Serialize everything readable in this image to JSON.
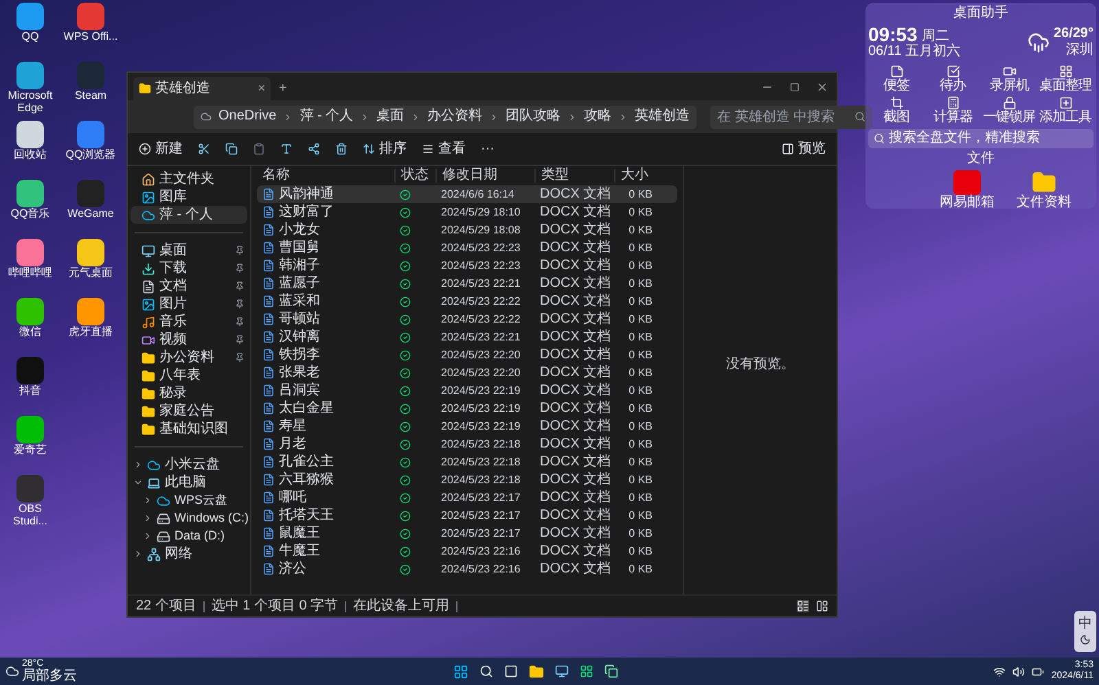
{
  "desktop_icons": [
    {
      "label": "QQ",
      "color": "#1d9bf0"
    },
    {
      "label": "WPS Offi...",
      "color": "#e53935"
    },
    {
      "label": "Microsoft Edge",
      "color": "#1fa4d8"
    },
    {
      "label": "Steam",
      "color": "#1b2838"
    },
    {
      "label": "回收站",
      "color": "#cfd8dc"
    },
    {
      "label": "QQ浏览器",
      "color": "#2f7df6"
    },
    {
      "label": "QQ音乐",
      "color": "#31c27c"
    },
    {
      "label": "WeGame",
      "color": "#222222"
    },
    {
      "label": "哔哩哔哩",
      "color": "#fb7299"
    },
    {
      "label": "元气桌面",
      "color": "#f5c518"
    },
    {
      "label": "微信",
      "color": "#2dc100"
    },
    {
      "label": "虎牙直播",
      "color": "#ff9600"
    },
    {
      "label": "抖音",
      "color": "#111111"
    },
    {
      "label": "爱奇艺",
      "color": "#00be06"
    },
    {
      "label": "OBS Studi...",
      "color": "#302e31"
    }
  ],
  "explorer": {
    "tab": {
      "title": "英雄创造",
      "close": "×",
      "new": "+"
    },
    "breadcrumbs": [
      "OneDrive",
      "萍 - 个人",
      "桌面",
      "办公资料",
      "团队攻略",
      "攻略",
      "英雄创造"
    ],
    "search": {
      "placeholder": "在 英雄创造 中搜索"
    },
    "toolbar": {
      "new": "新建",
      "sort": "排序",
      "view": "查看",
      "more": "···",
      "details": "预览"
    },
    "sidebar_top": [
      {
        "label": "主文件夹",
        "kind": "home",
        "selected": false
      },
      {
        "label": "图库",
        "kind": "image",
        "selected": false
      },
      {
        "label": "萍 - 个人",
        "kind": "cloud",
        "selected": true
      }
    ],
    "quick_access": [
      {
        "label": "桌面",
        "kind": "desktop",
        "pinned": true,
        "selected": false
      },
      {
        "label": "下载",
        "kind": "download",
        "pinned": true,
        "selected": false
      },
      {
        "label": "文档",
        "kind": "doc",
        "pinned": true,
        "selected": false
      },
      {
        "label": "图片",
        "kind": "image",
        "pinned": true,
        "selected": false
      },
      {
        "label": "音乐",
        "kind": "music",
        "pinned": true,
        "selected": false
      },
      {
        "label": "视频",
        "kind": "video",
        "pinned": true,
        "selected": false
      },
      {
        "label": "办公资料",
        "kind": "folder",
        "pinned": true,
        "selected": false
      },
      {
        "label": "八年表",
        "kind": "folder",
        "pinned": false,
        "selected": false
      },
      {
        "label": "秘录",
        "kind": "folder",
        "pinned": false,
        "selected": false
      },
      {
        "label": "家庭公告",
        "kind": "folder",
        "pinned": false,
        "selected": false
      },
      {
        "label": "基础知识图",
        "kind": "folder",
        "pinned": false,
        "selected": false
      }
    ],
    "tree": [
      {
        "label": "小米云盘",
        "kind": "cloud",
        "expanded": false
      },
      {
        "label": "此电脑",
        "kind": "pc",
        "expanded": true,
        "children": [
          {
            "label": "WPS云盘",
            "kind": "cloud",
            "expanded": false
          },
          {
            "label": "Windows (C:)",
            "kind": "drive",
            "expanded": false
          },
          {
            "label": "Data (D:)",
            "kind": "drive",
            "expanded": false
          }
        ]
      },
      {
        "label": "网络",
        "kind": "network",
        "expanded": false
      }
    ],
    "columns": [
      "名称",
      "状态",
      "修改日期",
      "类型",
      "大小"
    ],
    "rows": [
      {
        "name": "风韵神通",
        "date": "2024/6/6 16:14",
        "type": "DOCX 文档",
        "size": "0 KB",
        "selected": true
      },
      {
        "name": "这财富了",
        "date": "2024/5/29 18:10",
        "type": "DOCX 文档",
        "size": "0 KB",
        "selected": false
      },
      {
        "name": "小龙女",
        "date": "2024/5/29 18:08",
        "type": "DOCX 文档",
        "size": "0 KB",
        "selected": false
      },
      {
        "name": "曹国舅",
        "date": "2024/5/23 22:23",
        "type": "DOCX 文档",
        "size": "0 KB",
        "selected": false
      },
      {
        "name": "韩湘子",
        "date": "2024/5/23 22:23",
        "type": "DOCX 文档",
        "size": "0 KB",
        "selected": false
      },
      {
        "name": "蓝愿子",
        "date": "2024/5/23 22:21",
        "type": "DOCX 文档",
        "size": "0 KB",
        "selected": false
      },
      {
        "name": "蓝采和",
        "date": "2024/5/23 22:22",
        "type": "DOCX 文档",
        "size": "0 KB",
        "selected": false
      },
      {
        "name": "哥顿站",
        "date": "2024/5/23 22:22",
        "type": "DOCX 文档",
        "size": "0 KB",
        "selected": false
      },
      {
        "name": "汉钟离",
        "date": "2024/5/23 22:21",
        "type": "DOCX 文档",
        "size": "0 KB",
        "selected": false
      },
      {
        "name": "铁拐李",
        "date": "2024/5/23 22:20",
        "type": "DOCX 文档",
        "size": "0 KB",
        "selected": false
      },
      {
        "name": "张果老",
        "date": "2024/5/23 22:20",
        "type": "DOCX 文档",
        "size": "0 KB",
        "selected": false
      },
      {
        "name": "吕洞宾",
        "date": "2024/5/23 22:19",
        "type": "DOCX 文档",
        "size": "0 KB",
        "selected": false
      },
      {
        "name": "太白金星",
        "date": "2024/5/23 22:19",
        "type": "DOCX 文档",
        "size": "0 KB",
        "selected": false
      },
      {
        "name": "寿星",
        "date": "2024/5/23 22:19",
        "type": "DOCX 文档",
        "size": "0 KB",
        "selected": false
      },
      {
        "name": "月老",
        "date": "2024/5/23 22:18",
        "type": "DOCX 文档",
        "size": "0 KB",
        "selected": false
      },
      {
        "name": "孔雀公主",
        "date": "2024/5/23 22:18",
        "type": "DOCX 文档",
        "size": "0 KB",
        "selected": false
      },
      {
        "name": "六耳猕猴",
        "date": "2024/5/23 22:18",
        "type": "DOCX 文档",
        "size": "0 KB",
        "selected": false
      },
      {
        "name": "哪吒",
        "date": "2024/5/23 22:17",
        "type": "DOCX 文档",
        "size": "0 KB",
        "selected": false
      },
      {
        "name": "托塔天王",
        "date": "2024/5/23 22:17",
        "type": "DOCX 文档",
        "size": "0 KB",
        "selected": false
      },
      {
        "name": "鼠魔王",
        "date": "2024/5/23 22:17",
        "type": "DOCX 文档",
        "size": "0 KB",
        "selected": false
      },
      {
        "name": "牛魔王",
        "date": "2024/5/23 22:16",
        "type": "DOCX 文档",
        "size": "0 KB",
        "selected": false
      },
      {
        "name": "济公",
        "date": "2024/5/23 22:16",
        "type": "DOCX 文档",
        "size": "0 KB",
        "selected": false
      }
    ],
    "preview": "没有预览。",
    "status": [
      "22 个项目",
      "选中 1 个项目 0 字节",
      "在此设备上可用"
    ]
  },
  "widget": {
    "title": "桌面助手",
    "time": "09:53",
    "weekday": "周二",
    "date": "06/11 五月初六",
    "temp": "26/29°",
    "city": "深圳",
    "tools": [
      "便签",
      "待办",
      "录屏机",
      "桌面整理",
      "截图",
      "计算器",
      "一键锁屏",
      "添加工具"
    ],
    "search": "搜索全盘文件，精准搜索",
    "files_title": "文件",
    "files": [
      "网易邮箱",
      "文件资料"
    ]
  },
  "ime": "中",
  "taskbar": {
    "temp": "28°C",
    "weather": "局部多云",
    "time": "3:53",
    "date": "2024/6/11"
  }
}
